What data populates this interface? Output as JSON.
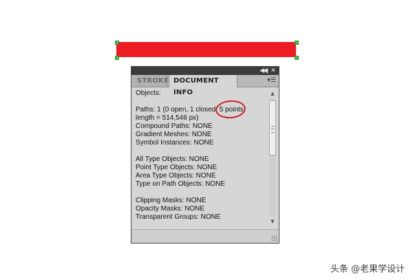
{
  "panel": {
    "tabs": [
      {
        "label": "STROKE",
        "active": false
      },
      {
        "label": "DOCUMENT INFO",
        "active": true
      }
    ],
    "collapse_icon": "double-left-arrow-icon",
    "close_icon": "close-icon",
    "menu_icon": "panel-menu-icon"
  },
  "document_info": {
    "lines": [
      "Objects:",
      "",
      "Paths: 1 (0 open, 1 closed, 5 points,",
      "length = 514,546 px)",
      "Compound Paths: NONE",
      "Gradient Meshes: NONE",
      "Symbol Instances: NONE",
      "",
      "All Type Objects: NONE",
      "Point Type Objects: NONE",
      "Area Type Objects: NONE",
      "Type on Path Objects: NONE",
      "",
      "Clipping Masks: NONE",
      "Opacity Masks: NONE",
      "Transparent Groups: NONE"
    ]
  },
  "artwork": {
    "fill_color": "#ed1c24",
    "anchor_color": "#4cc24c"
  },
  "annotation": {
    "color": "#d11f1f"
  },
  "watermark": "头条 @老果学设计"
}
